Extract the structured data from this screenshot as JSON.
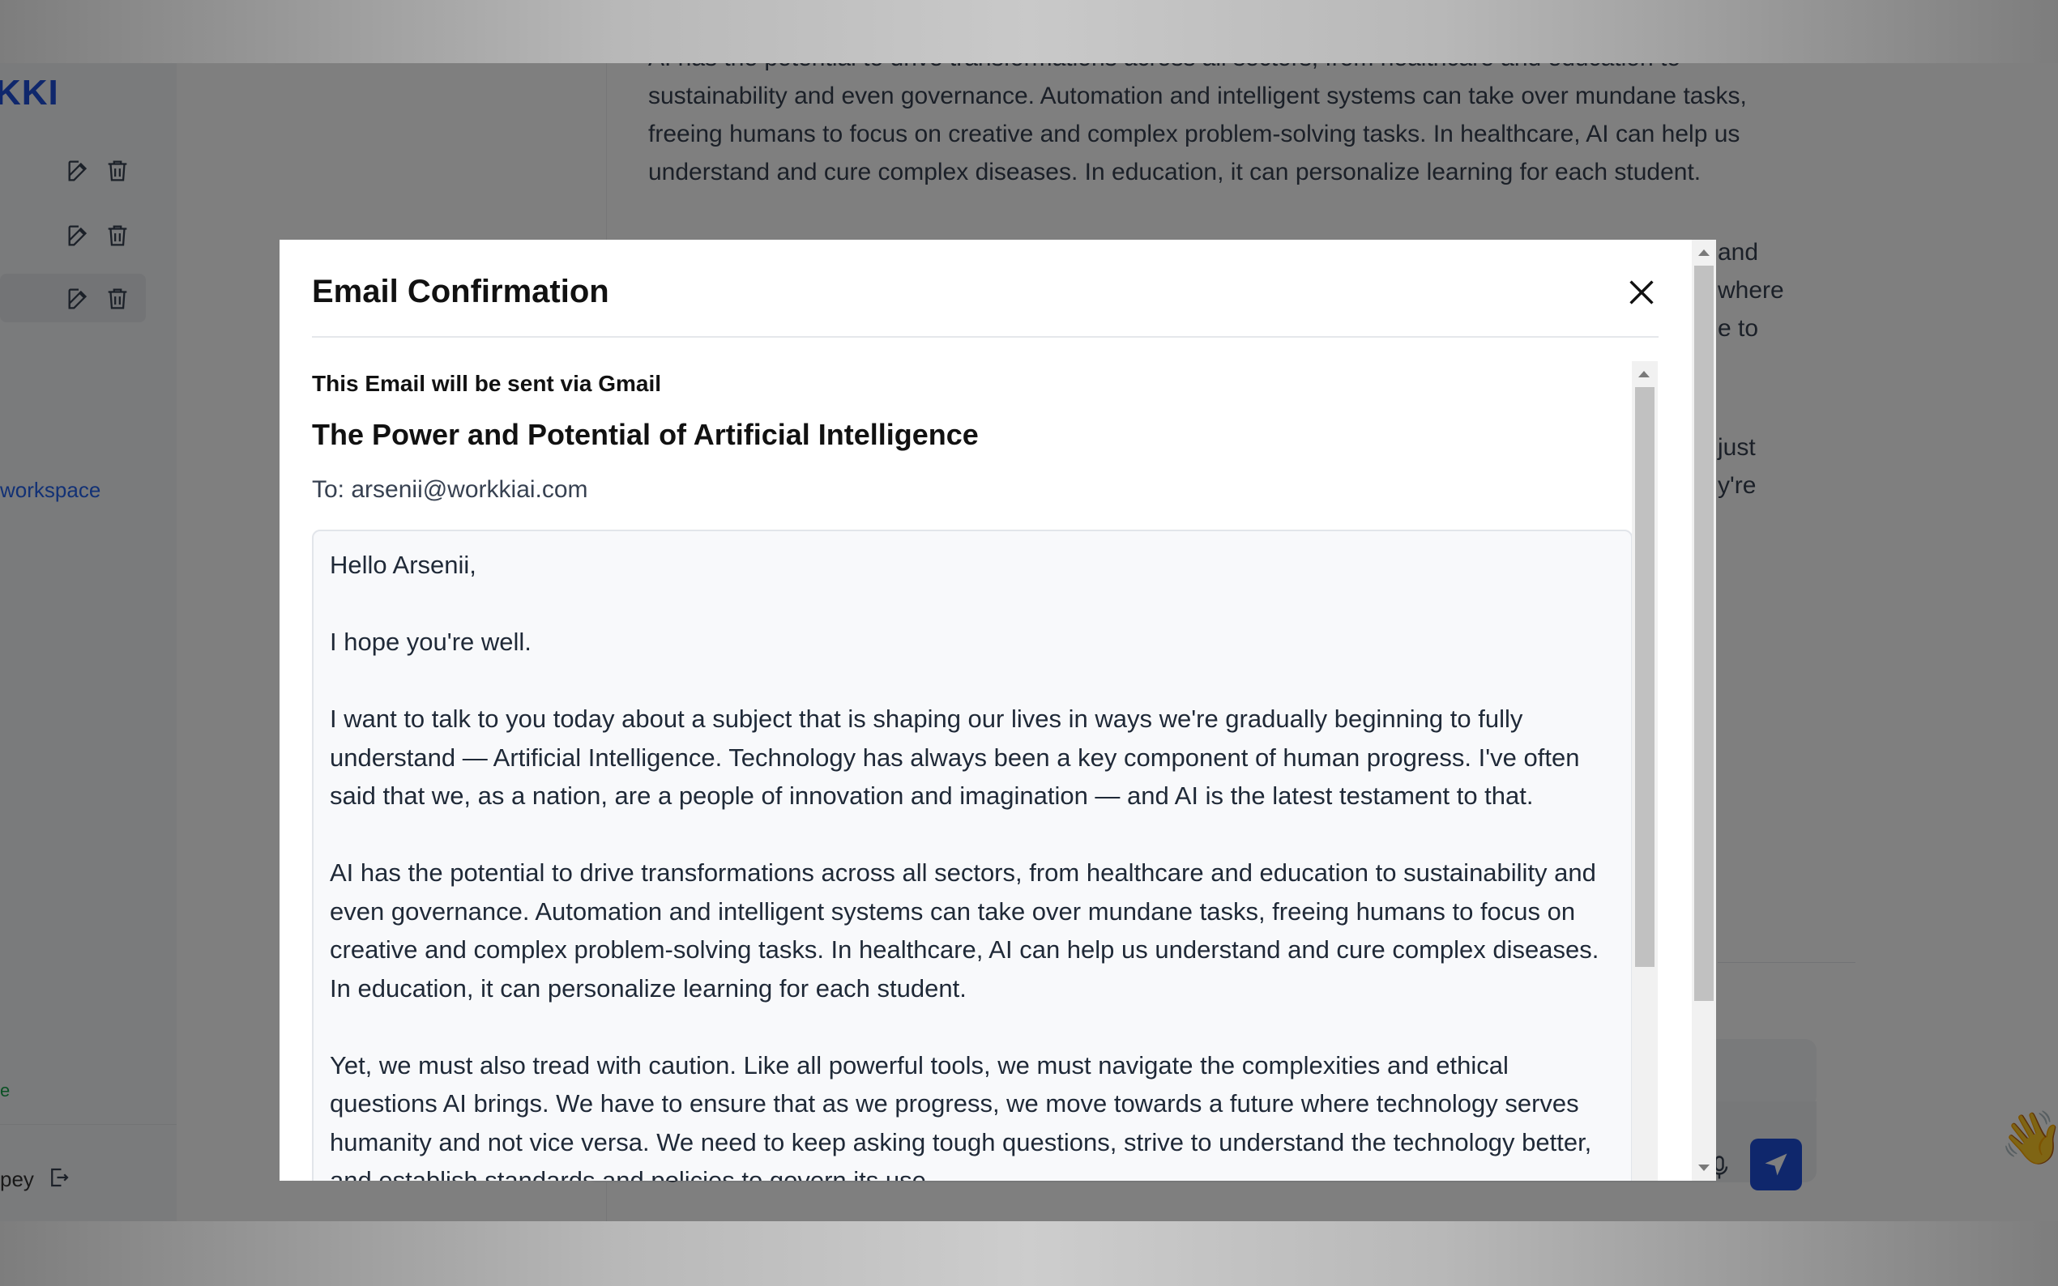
{
  "background_app": {
    "logo": "KKI",
    "sidebar": {
      "workspace_link": "workspace",
      "bottom_link": "e",
      "user_name": "pey"
    },
    "main_paragraphs": [
      "AI has the potential to drive transformations across all sectors, from healthcare and education to sustainability and even governance. Automation and intelligent systems can take over mundane tasks, freeing humans to focus on creative and complex problem-solving tasks. In healthcare, AI can help us understand and cure complex diseases. In education, it can personalize learning for each student."
    ],
    "right_fragments": [
      "and",
      "where",
      "e to",
      "just",
      "y're"
    ]
  },
  "modal": {
    "title": "Email Confirmation",
    "via_text": "This Email will be sent via Gmail",
    "subject": "The Power and Potential of Artificial Intelligence",
    "to_line": "To: arsenii@workkiai.com",
    "body_paragraphs": [
      "Hello Arsenii,",
      "I hope you're well.",
      "I want to talk to you today about a subject that is shaping our lives in ways we're gradually beginning to fully understand — Artificial Intelligence. Technology has always been a key component of human progress. I've often said that we, as a nation, are a people of innovation and imagination — and AI is the latest testament to that.",
      "AI has the potential to drive transformations across all sectors, from healthcare and education to sustainability and even governance. Automation and intelligent systems can take over mundane tasks, freeing humans to focus on creative and complex problem-solving tasks. In healthcare, AI can help us understand and cure complex diseases. In education, it can personalize learning for each student.",
      "Yet, we must also tread with caution. Like all powerful tools, we must navigate the complexities and ethical questions AI brings. We have to ensure that as we progress, we move towards a future where technology serves humanity and not vice versa. We need to keep asking tough questions, strive to understand the technology better, and establish standards and policies to govern its use."
    ]
  },
  "colors": {
    "accent": "#1e4fd8",
    "link": "#2563eb"
  },
  "icons": [
    "edit-icon",
    "trash-icon",
    "close-icon",
    "logout-icon",
    "slash-command-icon",
    "paperclip-icon",
    "microphone-icon",
    "send-icon",
    "waving-hand-icon"
  ]
}
